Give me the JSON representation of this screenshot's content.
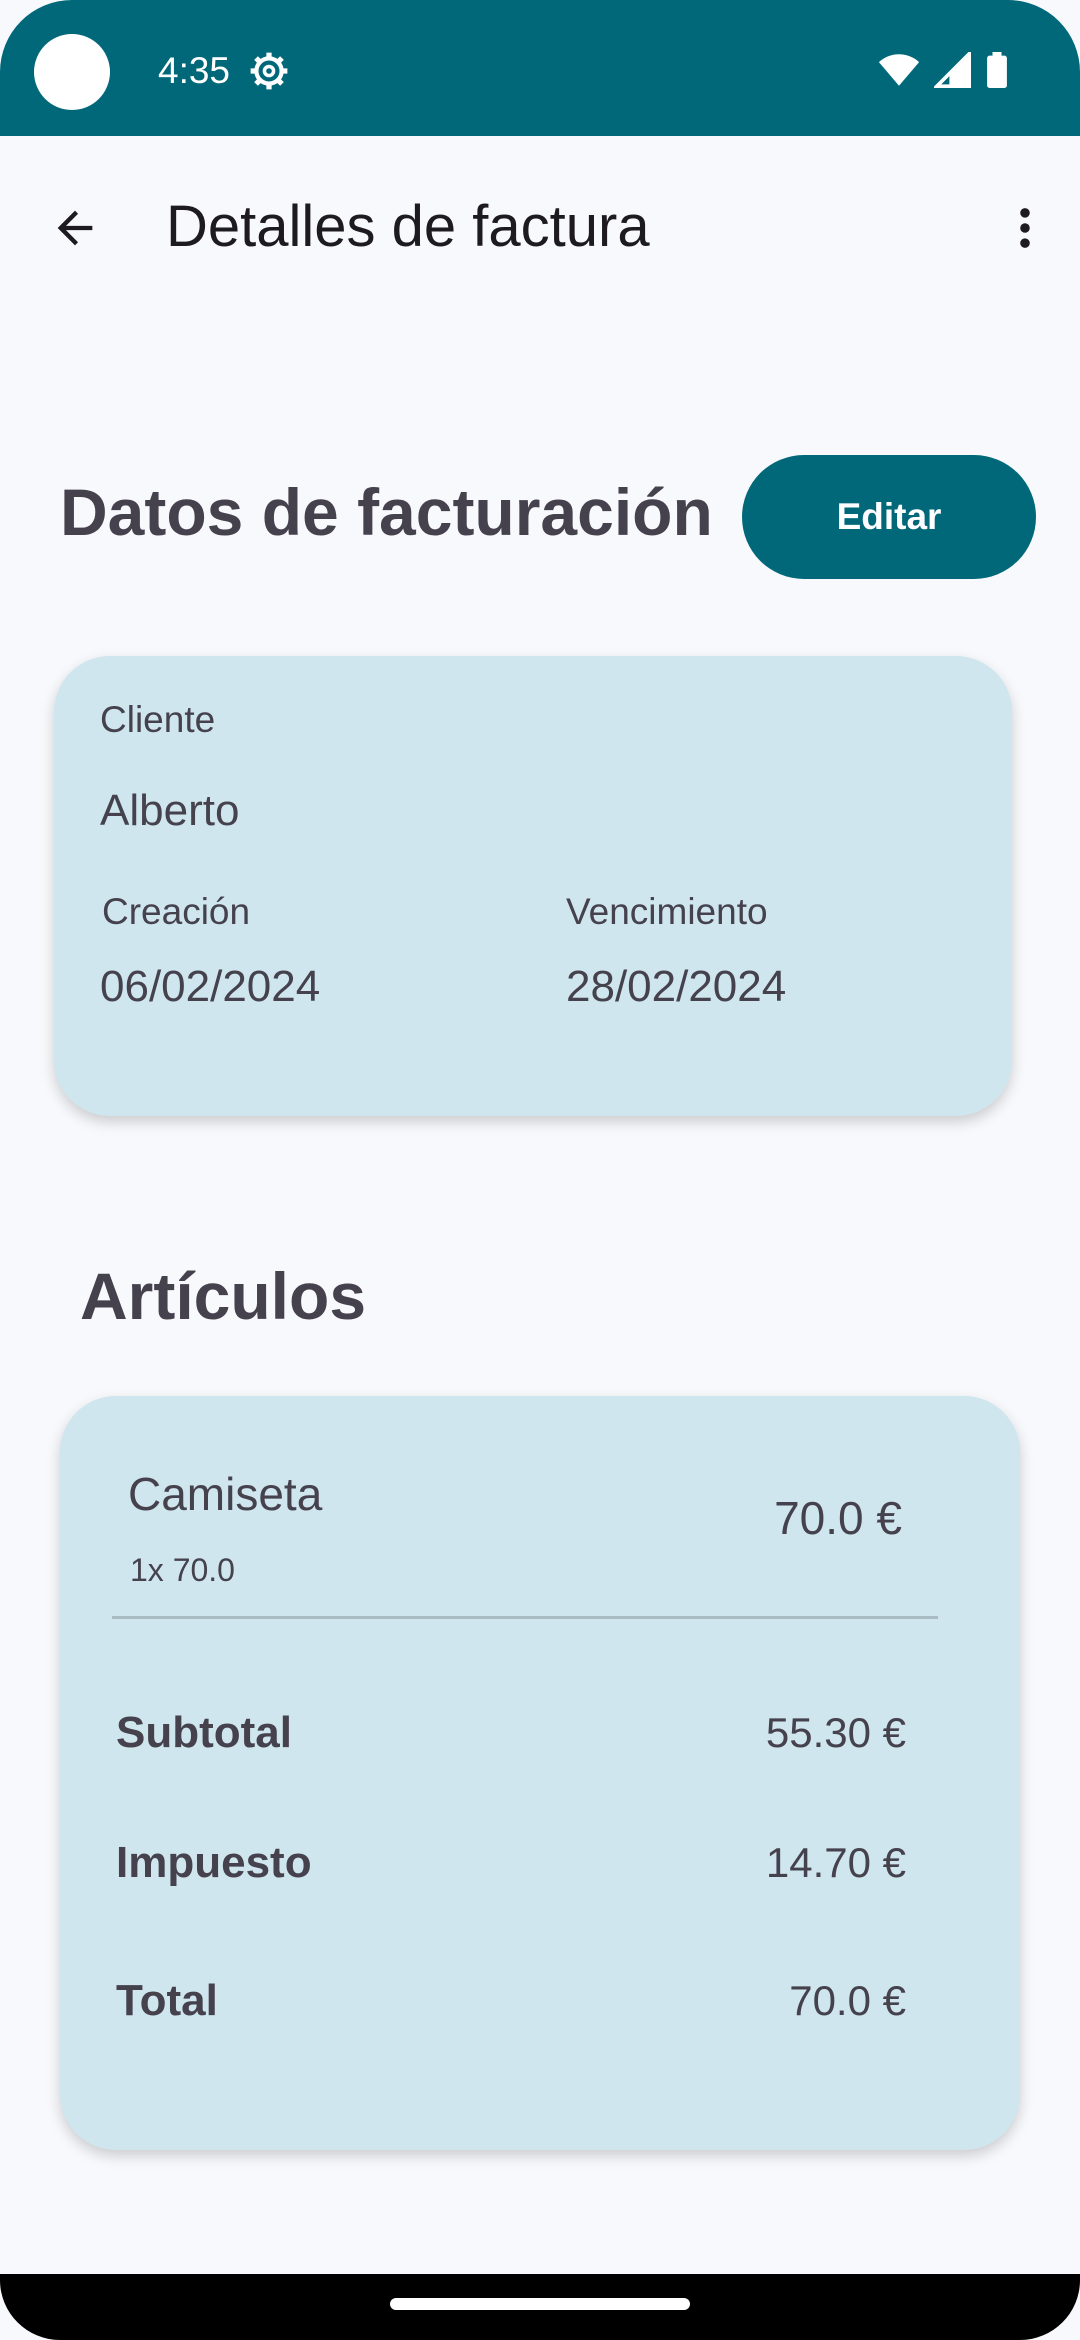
{
  "status_bar": {
    "time": "4:35",
    "icons": [
      "settings-gear-icon",
      "wifi-icon",
      "cell-signal-icon",
      "battery-icon"
    ]
  },
  "app_bar": {
    "title": "Detalles de factura",
    "back_icon": "arrow-back-icon",
    "menu_icon": "more-vert-icon"
  },
  "billing": {
    "section_title": "Datos de facturación",
    "edit_label": "Editar",
    "client_label": "Cliente",
    "client_value": "Alberto",
    "created_label": "Creación",
    "created_value": "06/02/2024",
    "due_label": "Vencimiento",
    "due_value": "28/02/2024"
  },
  "items": {
    "section_title": "Artículos",
    "list": [
      {
        "name": "Camiseta",
        "quantity": "1x 70.0",
        "price": "70.0 €"
      }
    ],
    "summary": [
      {
        "label": "Subtotal",
        "value": "55.30 €"
      },
      {
        "label": "Impuesto",
        "value": "14.70 €"
      },
      {
        "label": "Total",
        "value": "70.0 €"
      }
    ]
  },
  "colors": {
    "primary": "#006879",
    "card": "#cfe6ee",
    "background": "#f8f9fc",
    "text": "#45424e"
  }
}
